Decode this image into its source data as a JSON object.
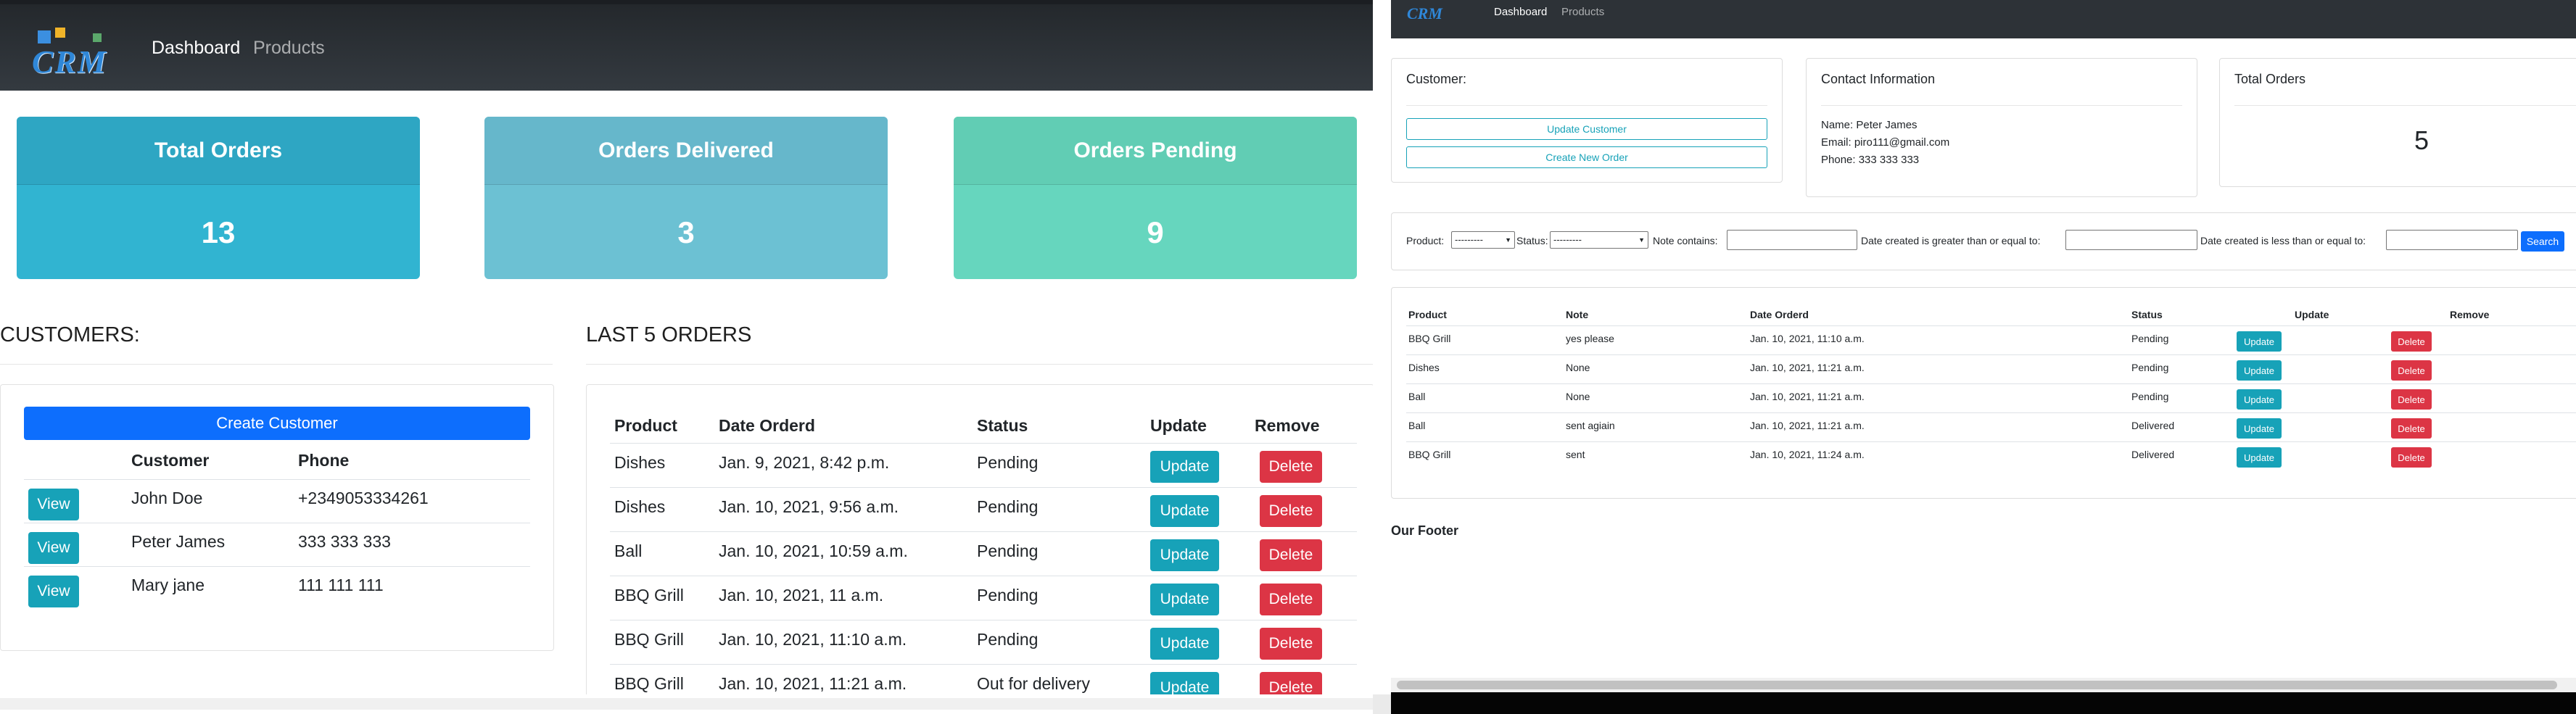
{
  "left": {
    "nav": {
      "logo_text": "CRM",
      "dashboard": "Dashboard",
      "products": "Products"
    },
    "cards": {
      "total": {
        "label": "Total Orders",
        "value": "13",
        "color": "#31b4d1"
      },
      "delivered": {
        "label": "Orders Delivered",
        "value": "3",
        "color": "#6cc1d3"
      },
      "pending": {
        "label": "Orders Pending",
        "value": "9",
        "color": "#66d6be"
      }
    },
    "customers": {
      "title": "CUSTOMERS:",
      "create_label": "Create Customer",
      "headers": {
        "customer": "Customer",
        "phone": "Phone"
      },
      "rows": [
        {
          "view": "View",
          "name": "John Doe",
          "phone": "+2349053334261"
        },
        {
          "view": "View",
          "name": "Peter James",
          "phone": "333 333 333"
        },
        {
          "view": "View",
          "name": "Mary jane",
          "phone": "111 111 111"
        }
      ]
    },
    "orders": {
      "title": "LAST 5 ORDERS",
      "headers": {
        "product": "Product",
        "date": "Date Orderd",
        "status": "Status",
        "update": "Update",
        "remove": "Remove"
      },
      "rows": [
        {
          "product": "Dishes",
          "date": "Jan. 9, 2021, 8:42 p.m.",
          "status": "Pending",
          "update": "Update",
          "delete": "Delete"
        },
        {
          "product": "Dishes",
          "date": "Jan. 10, 2021, 9:56 a.m.",
          "status": "Pending",
          "update": "Update",
          "delete": "Delete"
        },
        {
          "product": "Ball",
          "date": "Jan. 10, 2021, 10:59 a.m.",
          "status": "Pending",
          "update": "Update",
          "delete": "Delete"
        },
        {
          "product": "BBQ Grill",
          "date": "Jan. 10, 2021, 11 a.m.",
          "status": "Pending",
          "update": "Update",
          "delete": "Delete"
        },
        {
          "product": "BBQ Grill",
          "date": "Jan. 10, 2021, 11:10 a.m.",
          "status": "Pending",
          "update": "Update",
          "delete": "Delete"
        },
        {
          "product": "BBQ Grill",
          "date": "Jan. 10, 2021, 11:21 a.m.",
          "status": "Out for delivery",
          "update": "Update",
          "delete": "Delete"
        }
      ]
    }
  },
  "right": {
    "nav": {
      "logo_text": "CRM",
      "dashboard": "Dashboard",
      "products": "Products"
    },
    "customer_card": {
      "title": "Customer:",
      "update_label": "Update Customer",
      "new_order_label": "Create New Order"
    },
    "contact_card": {
      "title": "Contact Information",
      "name": "Name: Peter James",
      "email": "Email: piro111@gmail.com",
      "phone": "Phone: 333 333 333"
    },
    "orders_card": {
      "title": "Total Orders",
      "value": "5"
    },
    "filter": {
      "product_label": "Product:",
      "product_value": "---------",
      "status_label": "Status:",
      "status_value": "---------",
      "note_label": "Note contains:",
      "date_gte_label": "Date created is greater than or equal to:",
      "date_lte_label": "Date created is less than or equal to:",
      "search_label": "Search"
    },
    "table": {
      "headers": {
        "product": "Product",
        "note": "Note",
        "date": "Date Orderd",
        "status": "Status",
        "update": "Update",
        "remove": "Remove"
      },
      "rows": [
        {
          "product": "BBQ Grill",
          "note": "yes please",
          "date": "Jan. 10, 2021, 11:10 a.m.",
          "status": "Pending",
          "update": "Update",
          "delete": "Delete"
        },
        {
          "product": "Dishes",
          "note": "None",
          "date": "Jan. 10, 2021, 11:21 a.m.",
          "status": "Pending",
          "update": "Update",
          "delete": "Delete"
        },
        {
          "product": "Ball",
          "note": "None",
          "date": "Jan. 10, 2021, 11:21 a.m.",
          "status": "Pending",
          "update": "Update",
          "delete": "Delete"
        },
        {
          "product": "Ball",
          "note": "sent agiain",
          "date": "Jan. 10, 2021, 11:21 a.m.",
          "status": "Delivered",
          "update": "Update",
          "delete": "Delete"
        },
        {
          "product": "BBQ Grill",
          "note": "sent",
          "date": "Jan. 10, 2021, 11:24 a.m.",
          "status": "Delivered",
          "update": "Update",
          "delete": "Delete"
        }
      ]
    },
    "footer": "Our Footer"
  }
}
